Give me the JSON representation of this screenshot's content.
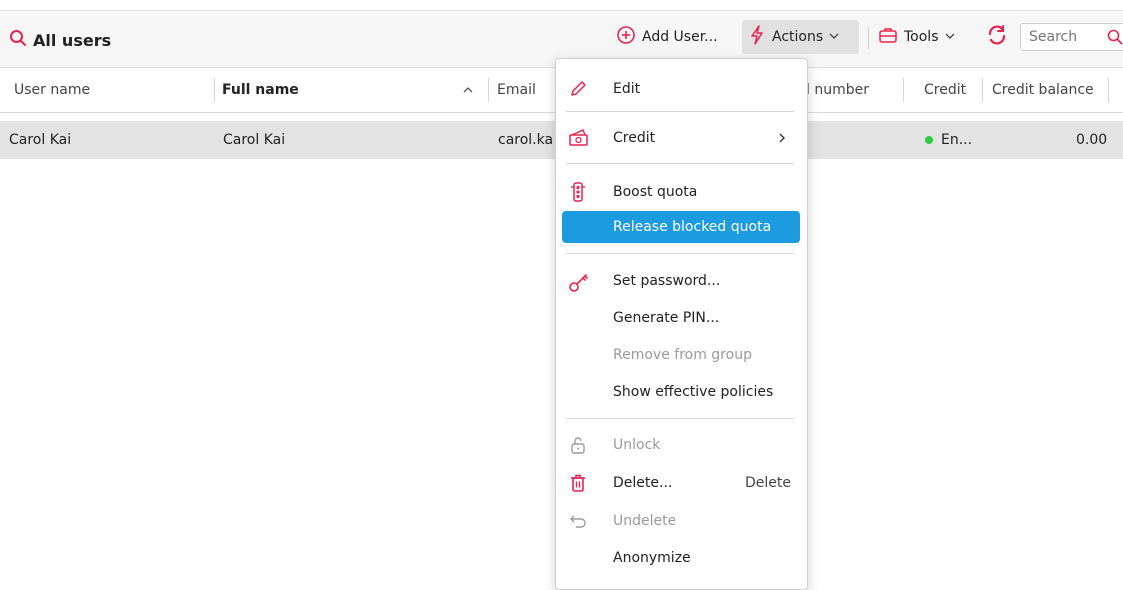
{
  "toolbar": {
    "title": "All users",
    "add_user": "Add User...",
    "actions": "Actions",
    "tools": "Tools",
    "search_placeholder": "Search"
  },
  "columns": [
    "User name",
    "Full name",
    "Email",
    "Personal number",
    "Credit",
    "Credit balance"
  ],
  "visible_column_labels": {
    "personal_number": "onal number"
  },
  "rows": [
    {
      "user_name": "Carol Kai",
      "full_name": "Carol Kai",
      "email": "carol.ka",
      "credit": "En...",
      "credit_balance": "0.00"
    }
  ],
  "menu": {
    "edit": "Edit",
    "credit": "Credit",
    "boost_quota": "Boost quota",
    "release_blocked_quota": "Release blocked quota",
    "set_password": "Set password...",
    "generate_pin": "Generate PIN...",
    "remove_from_group": "Remove from group",
    "show_effective_policies": "Show effective policies",
    "unlock": "Unlock",
    "delete": "Delete...",
    "delete_shortcut": "Delete",
    "undelete": "Undelete",
    "anonymize": "Anonymize"
  },
  "colors": {
    "accent": "#e8234d",
    "highlight": "#1c9be0",
    "status_green": "#2ecc40"
  },
  "icons": [
    "search-icon",
    "add-circle-icon",
    "lightning-icon",
    "toolbox-icon",
    "refresh-icon",
    "pencil-icon",
    "money-icon",
    "traffic-light-icon",
    "key-icon",
    "unlock-icon",
    "trash-icon",
    "undo-icon",
    "chevron-right-icon",
    "sort-up-icon"
  ]
}
